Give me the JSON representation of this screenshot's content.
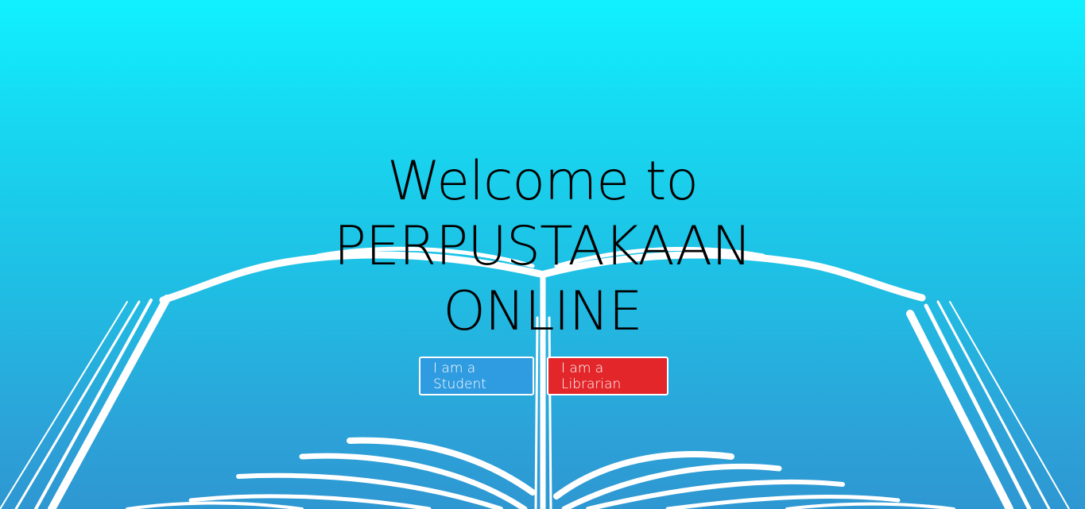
{
  "hero": {
    "title_line1": "Welcome to",
    "title_line2": "PERPUSTAKAAN",
    "title_line3": "ONLINE",
    "illustration": "open-book-illustration"
  },
  "actions": {
    "student_label": "I am a Student",
    "librarian_label": "I am a Librarian"
  },
  "colors": {
    "gradient_top": "#10f1ff",
    "gradient_bottom": "#2e97d2",
    "student_button": "#2f9be0",
    "librarian_button": "#e2262a",
    "book_lines": "#ffffff"
  }
}
